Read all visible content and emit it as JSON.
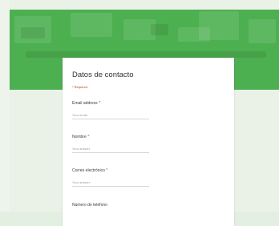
{
  "form": {
    "title": "Datos de contacto",
    "required_note": "* Required",
    "questions": [
      {
        "label": "Email address",
        "required": true,
        "placeholder": "Your email"
      },
      {
        "label": "Nombre",
        "required": true,
        "placeholder": "Your answer"
      },
      {
        "label": "Correo electrónico",
        "required": true,
        "placeholder": "Your answer"
      },
      {
        "label": "Número de teléfono",
        "required": false,
        "placeholder": ""
      }
    ]
  },
  "colors": {
    "banner": "#4caf50",
    "background": "#e3efe0",
    "required": "#d93025"
  }
}
